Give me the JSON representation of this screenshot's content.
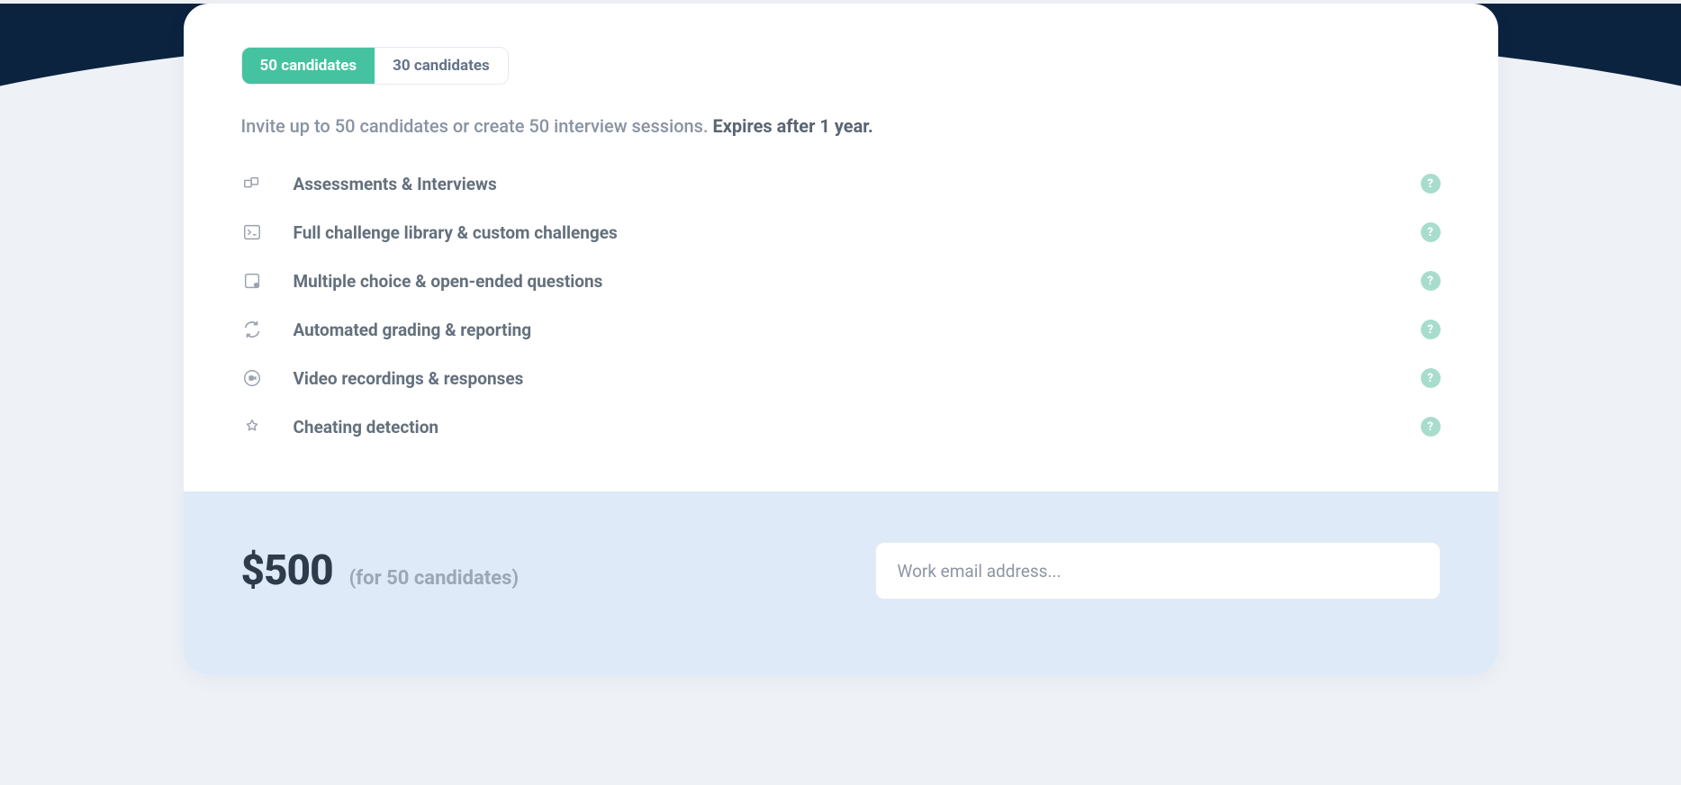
{
  "tabs": {
    "active": "50 candidates",
    "inactive": "30 candidates"
  },
  "description": {
    "text": "Invite up to 50 candidates or create 50 interview sessions. ",
    "strong": "Expires after 1 year."
  },
  "features": [
    {
      "label": "Assessments & Interviews"
    },
    {
      "label": "Full challenge library & custom challenges"
    },
    {
      "label": "Multiple choice & open-ended questions"
    },
    {
      "label": "Automated grading & reporting"
    },
    {
      "label": "Video recordings & responses"
    },
    {
      "label": "Cheating detection"
    }
  ],
  "help_glyph": "?",
  "pricing": {
    "amount": "$500",
    "note": "(for 50 candidates)"
  },
  "email": {
    "placeholder": "Work email address..."
  }
}
